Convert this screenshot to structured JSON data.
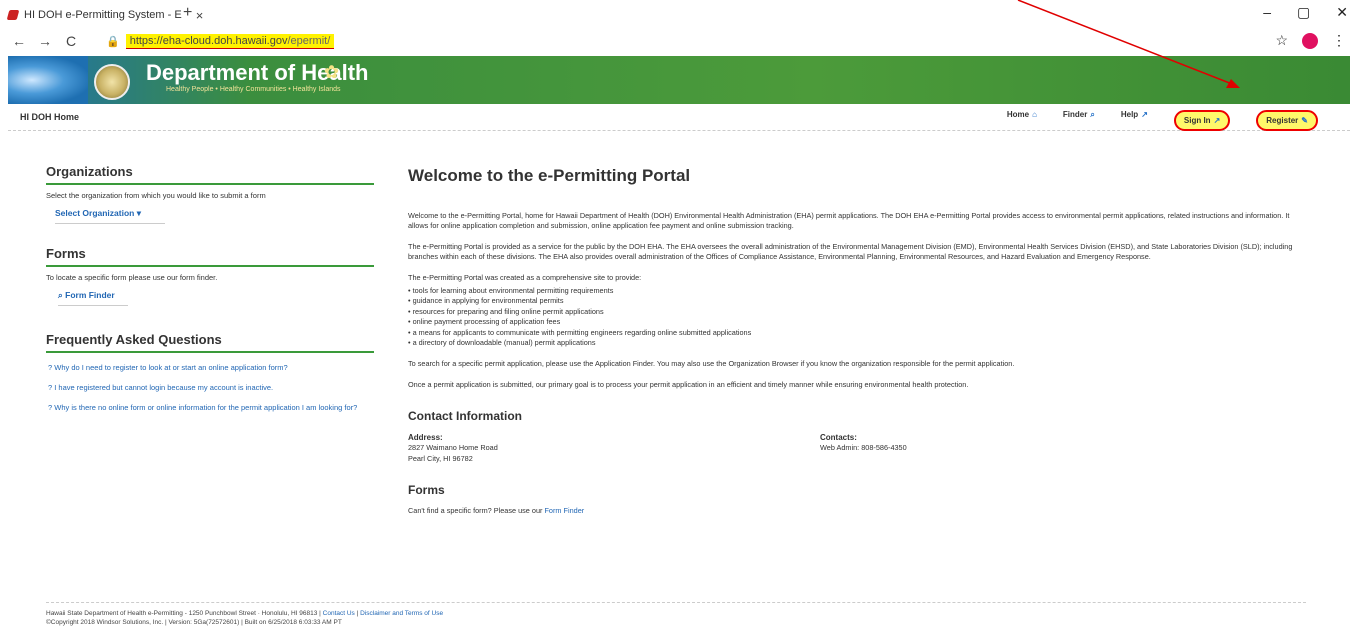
{
  "browser": {
    "tab_title": "HI DOH e-Permitting System - E",
    "url_host": "https://eha-cloud.doh.hawaii.gov",
    "url_path": "/epermit/"
  },
  "banner": {
    "title": "Department of Health",
    "subtitle": "Healthy People • Healthy Communities • Healthy Islands"
  },
  "sitenav": {
    "home": "HI DOH Home",
    "items": [
      "Home",
      "Finder",
      "Help",
      "Sign In",
      "Register"
    ]
  },
  "left": {
    "orgs_title": "Organizations",
    "orgs_desc": "Select the organization from which you would like to submit a form",
    "select_org": "Select Organization",
    "forms_title": "Forms",
    "forms_desc": "To locate a specific form please use our form finder.",
    "form_finder": "Form Finder",
    "faq_title": "Frequently Asked Questions",
    "faq": [
      "? Why do I need to register to look at or start an online application form?",
      "? I have registered but cannot login because my account is inactive.",
      "? Why is there no online form or online information for the permit application I am looking for?"
    ]
  },
  "main": {
    "title": "Welcome to the e-Permitting Portal",
    "p1": "Welcome to the e-Permitting Portal, home for Hawaii Department of Health (DOH) Environmental Health Administration (EHA) permit applications.  The DOH EHA e-Permitting Portal provides access to environmental permit applications, related instructions and information.  It allows for online application completion and submission, online application fee payment and online submission tracking.",
    "p2": "The e-Permitting Portal is provided as a service for the public by the DOH EHA.  The EHA oversees the overall administration of the Environmental Management Division (EMD), Environmental Health Services Division (EHSD), and State Laboratories Division (SLD); including branches within each of these divisions.  The EHA also provides overall administration of the Offices of Compliance Assistance, Environmental Planning, Environmental Resources, and Hazard Evaluation and Emergency Response.",
    "p3": "The e-Permitting Portal was created as a comprehensive site to provide:",
    "bullets": [
      "• tools for learning about environmental permitting requirements",
      "• guidance in applying for environmental permits",
      "• resources for preparing and filing online permit applications",
      "• online payment processing of application fees",
      "• a means for applicants to communicate with permitting engineers regarding online submitted applications",
      "• a directory of downloadable (manual) permit applications"
    ],
    "p4": "To search for a specific permit application, please use the Application Finder.  You may also use the Organization Browser if you know the organization responsible for the permit application.",
    "p5": "Once a permit application is submitted, our primary goal is to process your permit application in an efficient and timely manner while ensuring environmental health protection.",
    "contact_title": "Contact Information",
    "address_label": "Address:",
    "address_line1": "2827 Waimano Home Road",
    "address_line2": "Pearl City, HI 96782",
    "contacts_label": "Contacts:",
    "contacts_line": "Web Admin: 808-586-4350",
    "forms_title": "Forms",
    "forms_text": "Can't find a specific form? Please use our",
    "forms_link": "Form Finder"
  },
  "footer": {
    "line1": "Hawaii State Department of Health e-Permitting - 1250 Punchbowl Street · Honolulu, HI 96813  |",
    "contact": "Contact Us",
    "disclaimer": "Disclaimer and Terms of Use",
    "line2": "©Copyright 2018 Windsor Solutions, Inc. | Version: 5Ga(72572601) | Built on 6/25/2018 6:03:33 AM PT"
  },
  "colors": {
    "accent_green": "#3a9a3a",
    "link_blue": "#2267b4",
    "annotation_red": "#e00000",
    "highlight_yellow": "#fff86a"
  }
}
